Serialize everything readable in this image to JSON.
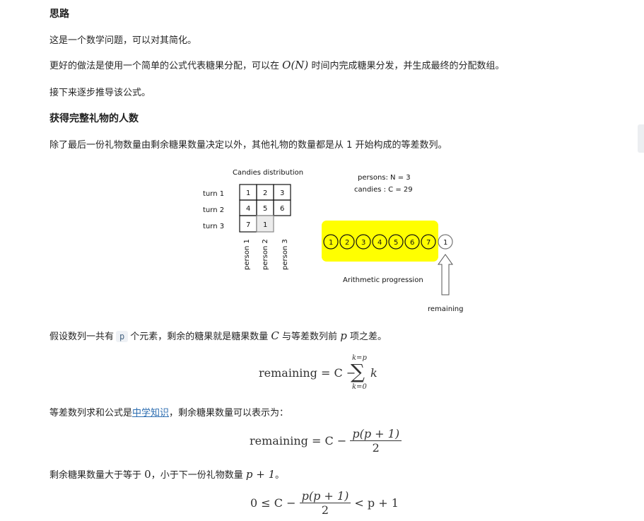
{
  "heading_approach": "思路",
  "para1": "这是一个数学问题，可以对其简化。",
  "para2_a": "更好的做法是使用一个简单的公式代表糖果分配，可以在",
  "para2_math": "O(N)",
  "para2_b": "时间内完成糖果分发，并生成最终的分配数组。",
  "para3": "接下来逐步推导该公式。",
  "heading_persons": "获得完整礼物的人数",
  "para4": "除了最后一份礼物数量由剩余糖果数量决定以外，其他礼物的数量都是从 1 开始构成的等差数列。",
  "figure": {
    "title": "Candies distribution",
    "persons_label": "persons: N = 3",
    "candies_label": "candies : C = 29",
    "turns": [
      "turn 1",
      "turn 2",
      "turn 3"
    ],
    "grid": [
      [
        "1",
        "2",
        "3"
      ],
      [
        "4",
        "5",
        "6"
      ],
      [
        "7",
        "1",
        ""
      ]
    ],
    "persons": [
      "person 1",
      "person 2",
      "person 3"
    ],
    "progression": [
      "1",
      "2",
      "3",
      "4",
      "5",
      "6",
      "7"
    ],
    "remaining_ball": "1",
    "progression_label": "Arithmetic progression",
    "remaining_label": "remaining",
    "highlight_color": "#ffff00"
  },
  "para5_a": "假设数列一共有",
  "para5_code": "p",
  "para5_b": "个元素，剩余的糖果就是糖果数量",
  "para5_c": "C",
  "para5_d": "与等差数列前",
  "para5_e": "p",
  "para5_f": "项之差。",
  "eq1": {
    "lhs": "remaining = C −",
    "sum_top": "k=p",
    "sum_bottom": "k=0",
    "sum_symbol": "∑",
    "term": "k"
  },
  "para6_a": "等差数列求和公式是",
  "para6_link": "中学知识",
  "para6_b": "，剩余糖果数量可以表示为：",
  "eq2": {
    "lhs": "remaining = C −",
    "num": "p(p + 1)",
    "den": "2"
  },
  "para7_a": "剩余糖果数量大于等于",
  "para7_zero": "0",
  "para7_b": "，小于下一份礼物数量",
  "para7_math": "p + 1",
  "para7_c": "。",
  "eq3": {
    "lhs": "0 ≤ C −",
    "num": "p(p + 1)",
    "den": "2",
    "rhs": "< p + 1"
  }
}
